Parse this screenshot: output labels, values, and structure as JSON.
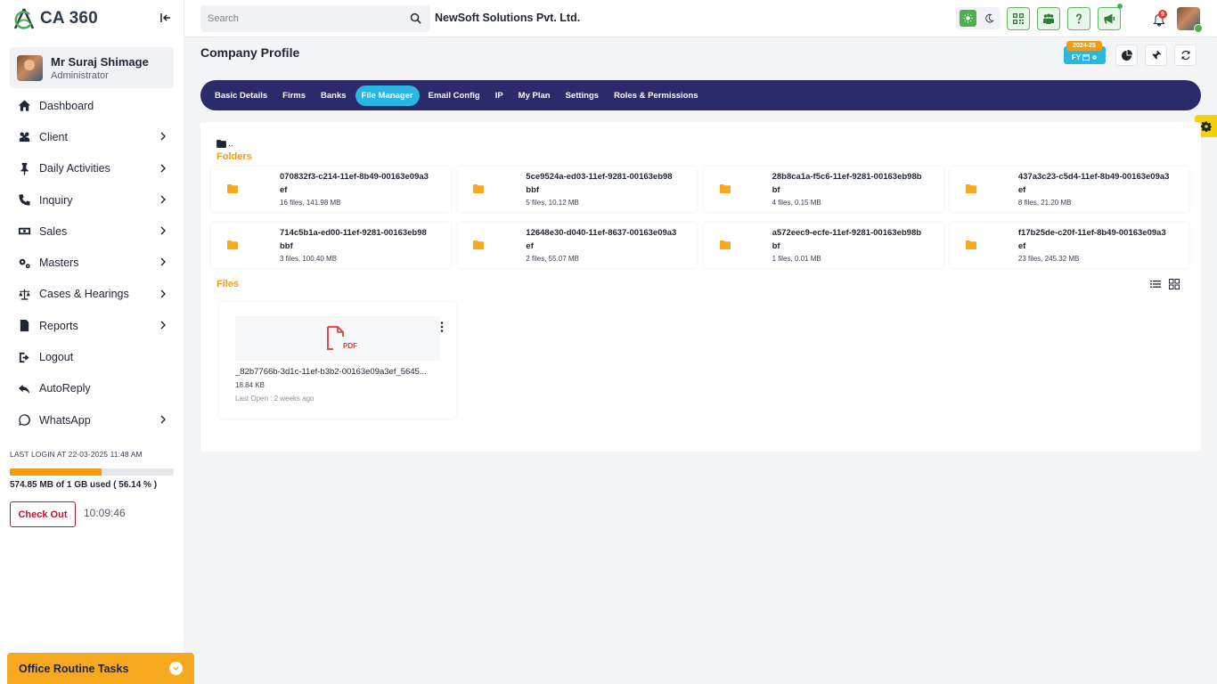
{
  "app": {
    "logo_text": "CA 360"
  },
  "user": {
    "name": "Mr Suraj Shimage",
    "role": "Administrator"
  },
  "sidebar": {
    "items": [
      {
        "label": "Dashboard",
        "icon": "home-icon",
        "has_children": false
      },
      {
        "label": "Client",
        "icon": "users-icon",
        "has_children": true
      },
      {
        "label": "Daily Activities",
        "icon": "pin-icon",
        "has_children": true
      },
      {
        "label": "Inquiry",
        "icon": "phone-icon",
        "has_children": true
      },
      {
        "label": "Sales",
        "icon": "cash-icon",
        "has_children": true
      },
      {
        "label": "Masters",
        "icon": "gears-icon",
        "has_children": true
      },
      {
        "label": "Cases & Hearings",
        "icon": "scale-icon",
        "has_children": true
      },
      {
        "label": "Reports",
        "icon": "file-icon",
        "has_children": true
      },
      {
        "label": "Logout",
        "icon": "logout-icon",
        "has_children": false
      },
      {
        "label": "AutoReply",
        "icon": "reply-all-icon",
        "has_children": false
      },
      {
        "label": "WhatsApp",
        "icon": "whatsapp-icon",
        "has_children": true
      }
    ],
    "last_login": "LAST LOGIN AT 22-03-2025 11:48 AM",
    "storage": {
      "used_fraction": 0.5614,
      "label": "574.85 MB of 1 GB used ( 56.14 % )"
    },
    "checkout_label": "Check Out",
    "clock": "10:09:46",
    "routine_label": "Office Routine Tasks"
  },
  "topbar": {
    "search_placeholder": "Search",
    "company": "NewSoft Solutions Pvt. Ltd.",
    "notification_count": "9"
  },
  "header": {
    "title": "Company Profile",
    "fy_year": "2024-25",
    "fy_label": "FY"
  },
  "tabs": [
    {
      "label": "Basic Details",
      "active": false
    },
    {
      "label": "Firms",
      "active": false
    },
    {
      "label": "Banks",
      "active": false
    },
    {
      "label": "File Manager",
      "active": true
    },
    {
      "label": "Email Config",
      "active": false
    },
    {
      "label": "IP",
      "active": false
    },
    {
      "label": "My Plan",
      "active": false
    },
    {
      "label": "Settings",
      "active": false
    },
    {
      "label": "Roles & Permissions",
      "active": false
    }
  ],
  "file_manager": {
    "breadcrumb": "..",
    "folders_title": "Folders",
    "files_title": "Files",
    "folders": [
      {
        "name": "070832f3-c214-11ef-8b49-00163e09a3ef",
        "meta": "16 files, 141.98 MB"
      },
      {
        "name": "5ce9524a-ed03-11ef-9281-00163eb98bbf",
        "meta": "5 files, 10.12 MB"
      },
      {
        "name": "28b8ca1a-f5c6-11ef-9281-00163eb98bbf",
        "meta": "4 files, 0.15 MB"
      },
      {
        "name": "437a3c23-c5d4-11ef-8b49-00163e09a3ef",
        "meta": "8 files, 21.20 MB"
      },
      {
        "name": "714c5b1a-ed00-11ef-9281-00163eb98bbf",
        "meta": "3 files, 100.40 MB"
      },
      {
        "name": "12648e30-d040-11ef-8637-00163e09a3ef",
        "meta": "2 files, 55.07 MB"
      },
      {
        "name": "a572eec9-ecfe-11ef-9281-00163eb98bbf",
        "meta": "1 files, 0.01 MB"
      },
      {
        "name": "f17b25de-c20f-11ef-8b49-00163e09a3ef",
        "meta": "23 files, 245.32 MB"
      }
    ],
    "files": [
      {
        "name": "_82b7766b-3d1c-11ef-b3b2-00163e09a3ef_5645...",
        "size": "18.84 KB",
        "last_open": "Last Open : 2 weeks ago",
        "type_label": "PDF"
      }
    ]
  },
  "colors": {
    "accent": "#f39c12",
    "tabbar": "#2b2a6b",
    "active_tab": "#29b6e0",
    "brand_green": "#4caf50",
    "danger": "#c8102e"
  }
}
